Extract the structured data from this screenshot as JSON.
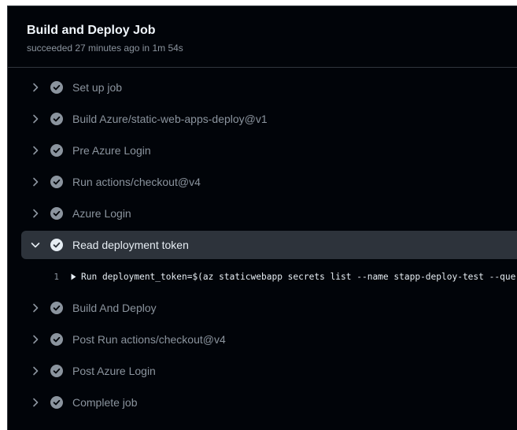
{
  "job": {
    "title": "Build and Deploy Job",
    "meta": "succeeded 27 minutes ago in 1m 54s"
  },
  "steps_before": [
    {
      "label": "Set up job",
      "icon": "check-circle-icon"
    },
    {
      "label": "Build Azure/static-web-apps-deploy@v1",
      "icon": "check-circle-icon"
    },
    {
      "label": "Pre Azure Login",
      "icon": "check-circle-icon"
    },
    {
      "label": "Run actions/checkout@v4",
      "icon": "check-circle-icon"
    },
    {
      "label": "Azure Login",
      "icon": "check-circle-icon"
    }
  ],
  "expanded_step": {
    "label": "Read deployment token",
    "icon": "check-circle-icon",
    "log": {
      "line_number": "1",
      "text": "Run deployment_token=$(az staticwebapp secrets list --name stapp-deploy-test --query"
    }
  },
  "steps_after": [
    {
      "label": "Build And Deploy",
      "icon": "check-circle-icon"
    },
    {
      "label": "Post Run actions/checkout@v4",
      "icon": "check-circle-icon"
    },
    {
      "label": "Post Azure Login",
      "icon": "check-circle-icon"
    },
    {
      "label": "Complete job",
      "icon": "check-circle-icon"
    }
  ],
  "colors": {
    "background": "#010409",
    "expanded_row": "#2d333b",
    "muted_text": "#8b949e",
    "bright_text": "#e6edf3",
    "check_muted": "#8b949e",
    "check_bright": "#e6edf3"
  }
}
